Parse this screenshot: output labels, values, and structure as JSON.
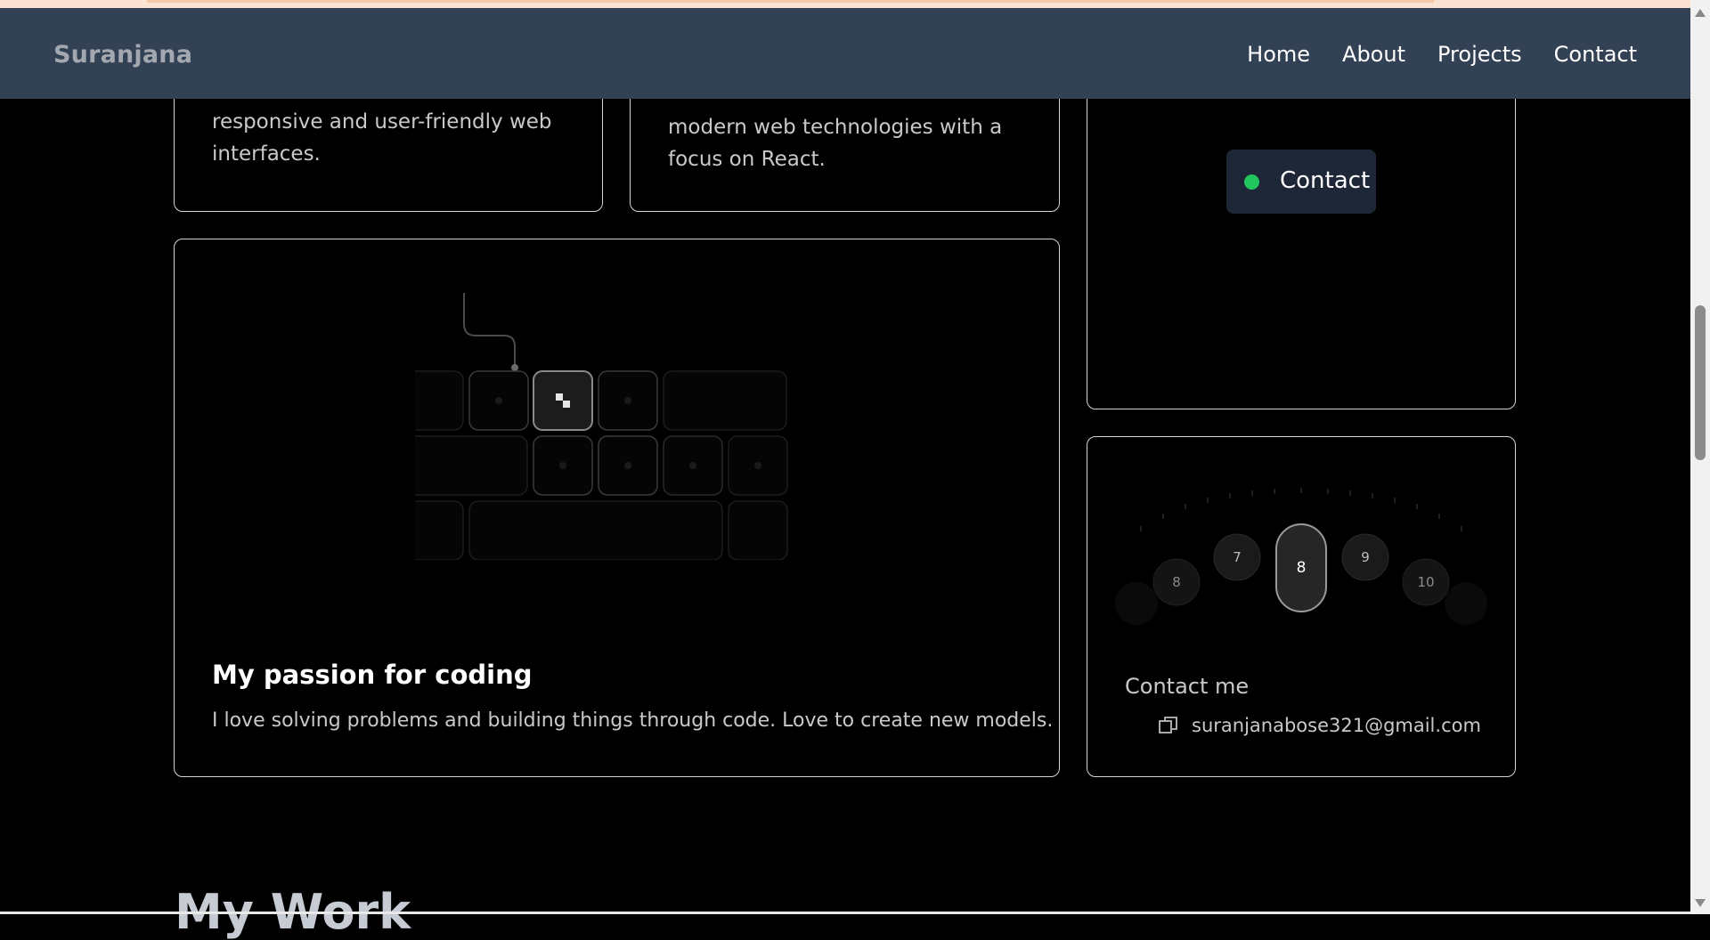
{
  "nav": {
    "brand": "Suranjana",
    "links": [
      "Home",
      "About",
      "Projects",
      "Contact"
    ]
  },
  "card_left": {
    "lines": [
      "responsive and user-friendly web",
      "interfaces."
    ]
  },
  "card_middle": {
    "lines": [
      "modern web technologies with a",
      "focus on React."
    ]
  },
  "contact_badge": {
    "label": "Contact",
    "status_color": "#22c55e"
  },
  "passion": {
    "title": "My passion for coding",
    "description": "I love solving problems and building things through code. Love to create new models."
  },
  "contact_card": {
    "dial_numbers": [
      "8",
      "7",
      "8",
      "9",
      "10"
    ],
    "selected_number": "8",
    "title": "Contact me",
    "email": "suranjanabose321@gmail.com",
    "copy_icon": "copy-icon"
  },
  "section": {
    "title": "My Work"
  },
  "colors": {
    "navbar": "#334155",
    "background": "#000000",
    "accent_green": "#22c55e"
  }
}
